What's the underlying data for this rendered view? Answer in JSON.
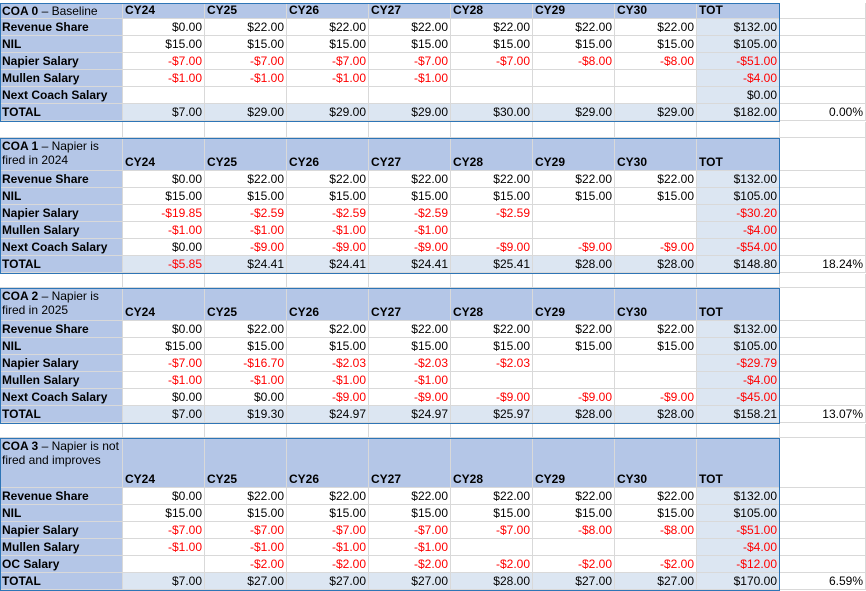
{
  "columns": [
    "CY24",
    "CY25",
    "CY26",
    "CY27",
    "CY28",
    "CY29",
    "CY30",
    "TOT"
  ],
  "colors": {
    "header_blue": "#b4c6e7",
    "total_blue": "#dce6f2",
    "negative": "#ff0000",
    "border": "#2e75b6"
  },
  "blocks": [
    {
      "title_bold": "COA 0",
      "title_rest": " – Baseline",
      "rows": [
        {
          "label": "Revenue Share",
          "values": [
            "$0.00",
            "$22.00",
            "$22.00",
            "$22.00",
            "$22.00",
            "$22.00",
            "$22.00",
            "$132.00"
          ]
        },
        {
          "label": "NIL",
          "values": [
            "$15.00",
            "$15.00",
            "$15.00",
            "$15.00",
            "$15.00",
            "$15.00",
            "$15.00",
            "$105.00"
          ]
        },
        {
          "label": "Napier Salary",
          "values": [
            "-$7.00",
            "-$7.00",
            "-$7.00",
            "-$7.00",
            "-$7.00",
            "-$8.00",
            "-$8.00",
            "-$51.00"
          ]
        },
        {
          "label": "Mullen Salary",
          "values": [
            "-$1.00",
            "-$1.00",
            "-$1.00",
            "-$1.00",
            "",
            "",
            "",
            "-$4.00"
          ]
        },
        {
          "label": "Next Coach Salary",
          "values": [
            "",
            "",
            "",
            "",
            "",
            "",
            "",
            "$0.00"
          ]
        }
      ],
      "total": {
        "label": "TOTAL",
        "values": [
          "$7.00",
          "$29.00",
          "$29.00",
          "$29.00",
          "$30.00",
          "$29.00",
          "$29.00",
          "$182.00"
        ],
        "pct": "0.00%"
      }
    },
    {
      "title_bold": "COA 1",
      "title_rest": " – Napier is fired in 2024",
      "rows": [
        {
          "label": "Revenue Share",
          "values": [
            "$0.00",
            "$22.00",
            "$22.00",
            "$22.00",
            "$22.00",
            "$22.00",
            "$22.00",
            "$132.00"
          ]
        },
        {
          "label": "NIL",
          "values": [
            "$15.00",
            "$15.00",
            "$15.00",
            "$15.00",
            "$15.00",
            "$15.00",
            "$15.00",
            "$105.00"
          ]
        },
        {
          "label": "Napier Salary",
          "values": [
            "-$19.85",
            "-$2.59",
            "-$2.59",
            "-$2.59",
            "-$2.59",
            "",
            "",
            "-$30.20"
          ]
        },
        {
          "label": "Mullen Salary",
          "values": [
            "-$1.00",
            "-$1.00",
            "-$1.00",
            "-$1.00",
            "",
            "",
            "",
            "-$4.00"
          ]
        },
        {
          "label": "Next Coach Salary",
          "values": [
            "$0.00",
            "-$9.00",
            "-$9.00",
            "-$9.00",
            "-$9.00",
            "-$9.00",
            "-$9.00",
            "-$54.00"
          ]
        }
      ],
      "total": {
        "label": "TOTAL",
        "values": [
          "-$5.85",
          "$24.41",
          "$24.41",
          "$24.41",
          "$25.41",
          "$28.00",
          "$28.00",
          "$148.80"
        ],
        "pct": "18.24%"
      }
    },
    {
      "title_bold": "COA 2",
      "title_rest": " – Napier is fired in 2025",
      "rows": [
        {
          "label": "Revenue Share",
          "values": [
            "$0.00",
            "$22.00",
            "$22.00",
            "$22.00",
            "$22.00",
            "$22.00",
            "$22.00",
            "$132.00"
          ]
        },
        {
          "label": "NIL",
          "values": [
            "$15.00",
            "$15.00",
            "$15.00",
            "$15.00",
            "$15.00",
            "$15.00",
            "$15.00",
            "$105.00"
          ]
        },
        {
          "label": "Napier Salary",
          "values": [
            "-$7.00",
            "-$16.70",
            "-$2.03",
            "-$2.03",
            "-$2.03",
            "",
            "",
            "-$29.79"
          ]
        },
        {
          "label": "Mullen Salary",
          "values": [
            "-$1.00",
            "-$1.00",
            "-$1.00",
            "-$1.00",
            "",
            "",
            "",
            "-$4.00"
          ]
        },
        {
          "label": "Next Coach Salary",
          "values": [
            "$0.00",
            "$0.00",
            "-$9.00",
            "-$9.00",
            "-$9.00",
            "-$9.00",
            "-$9.00",
            "-$45.00"
          ]
        }
      ],
      "total": {
        "label": "TOTAL",
        "values": [
          "$7.00",
          "$19.30",
          "$24.97",
          "$24.97",
          "$25.97",
          "$28.00",
          "$28.00",
          "$158.21"
        ],
        "pct": "13.07%"
      }
    },
    {
      "title_bold": "COA 3",
      "title_rest": " – Napier is not fired and improves",
      "rows": [
        {
          "label": "Revenue Share",
          "values": [
            "$0.00",
            "$22.00",
            "$22.00",
            "$22.00",
            "$22.00",
            "$22.00",
            "$22.00",
            "$132.00"
          ]
        },
        {
          "label": "NIL",
          "values": [
            "$15.00",
            "$15.00",
            "$15.00",
            "$15.00",
            "$15.00",
            "$15.00",
            "$15.00",
            "$105.00"
          ]
        },
        {
          "label": "Napier Salary",
          "values": [
            "-$7.00",
            "-$7.00",
            "-$7.00",
            "-$7.00",
            "-$7.00",
            "-$8.00",
            "-$8.00",
            "-$51.00"
          ]
        },
        {
          "label": "Mullen Salary",
          "values": [
            "-$1.00",
            "-$1.00",
            "-$1.00",
            "-$1.00",
            "",
            "",
            "",
            "-$4.00"
          ]
        },
        {
          "label": "OC Salary",
          "values": [
            "",
            "-$2.00",
            "-$2.00",
            "-$2.00",
            "-$2.00",
            "-$2.00",
            "-$2.00",
            "-$12.00"
          ]
        }
      ],
      "total": {
        "label": "TOTAL",
        "values": [
          "$7.00",
          "$27.00",
          "$27.00",
          "$27.00",
          "$28.00",
          "$27.00",
          "$27.00",
          "$170.00"
        ],
        "pct": "6.59%"
      }
    }
  ]
}
